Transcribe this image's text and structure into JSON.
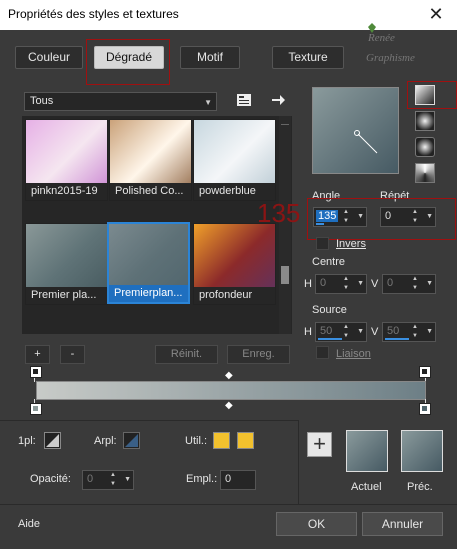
{
  "window": {
    "title": "Propriétés des styles et textures",
    "close_glyph": "✕"
  },
  "tabs": [
    {
      "label": "Couleur"
    },
    {
      "label": "Dégradé"
    },
    {
      "label": "Motif"
    },
    {
      "label": "Texture"
    }
  ],
  "watermark": {
    "line1": "Renée",
    "line2": "Graphisme"
  },
  "gallery": {
    "category": "Tous",
    "items": [
      {
        "label": "pinkn2015-19",
        "colors": [
          "#e6b0e6",
          "#f5e6f0",
          "#c77fd0"
        ]
      },
      {
        "label": "Polished Co...",
        "colors": [
          "#caa27a",
          "#fff6ea",
          "#8a5f3c"
        ]
      },
      {
        "label": "powderblue",
        "colors": [
          "#c7d7df",
          "#f4f6f8",
          "#b4c6d0"
        ]
      },
      {
        "label": "Premier pla...",
        "colors": [
          "#8a9898",
          "#5f7377",
          "#44575c"
        ]
      },
      {
        "label": "Premierplan...",
        "colors": [
          "#7b8a8f",
          "#5e7177",
          "#4f646c"
        ]
      },
      {
        "label": "profondeur",
        "colors": [
          "#f0a02a",
          "#8c2a2a",
          "#5a3366"
        ]
      }
    ],
    "add_label": "+",
    "remove_label": "-",
    "reset_label": "Réinit.",
    "save_label": "Enreg."
  },
  "preview": {
    "colors": [
      "#8a9a9c",
      "#465a63"
    ]
  },
  "angle": {
    "label": "Angle",
    "value": "135",
    "annotation": "135"
  },
  "repeat": {
    "label": "Répét",
    "value": "0"
  },
  "invert": {
    "label": "Invers",
    "checked": false
  },
  "center": {
    "label": "Centre",
    "h_label": "H",
    "h_value": "0",
    "v_label": "V",
    "v_value": "0"
  },
  "source": {
    "label": "Source",
    "h_label": "H",
    "h_value": "50",
    "v_label": "V",
    "v_value": "50"
  },
  "link": {
    "label": "Liaison"
  },
  "gradient_bar": {
    "colors": [
      "#c8cbc8",
      "#6d7f86"
    ]
  },
  "markers": {
    "stop": "◆"
  },
  "stroke": {
    "pl_label": "1pl:",
    "arpl_label": "Arpl:",
    "util_label": "Util.:",
    "opacity_label": "Opacité:",
    "opacity_value": "0",
    "empl_label": "Empl.:",
    "empl_value": "0",
    "colors": {
      "swatch": "#f2c12e"
    }
  },
  "current": {
    "label": "Actuel"
  },
  "previous": {
    "label": "Préc."
  },
  "add_glyph": "+",
  "footer": {
    "help": "Aide",
    "ok": "OK",
    "cancel": "Annuler"
  }
}
